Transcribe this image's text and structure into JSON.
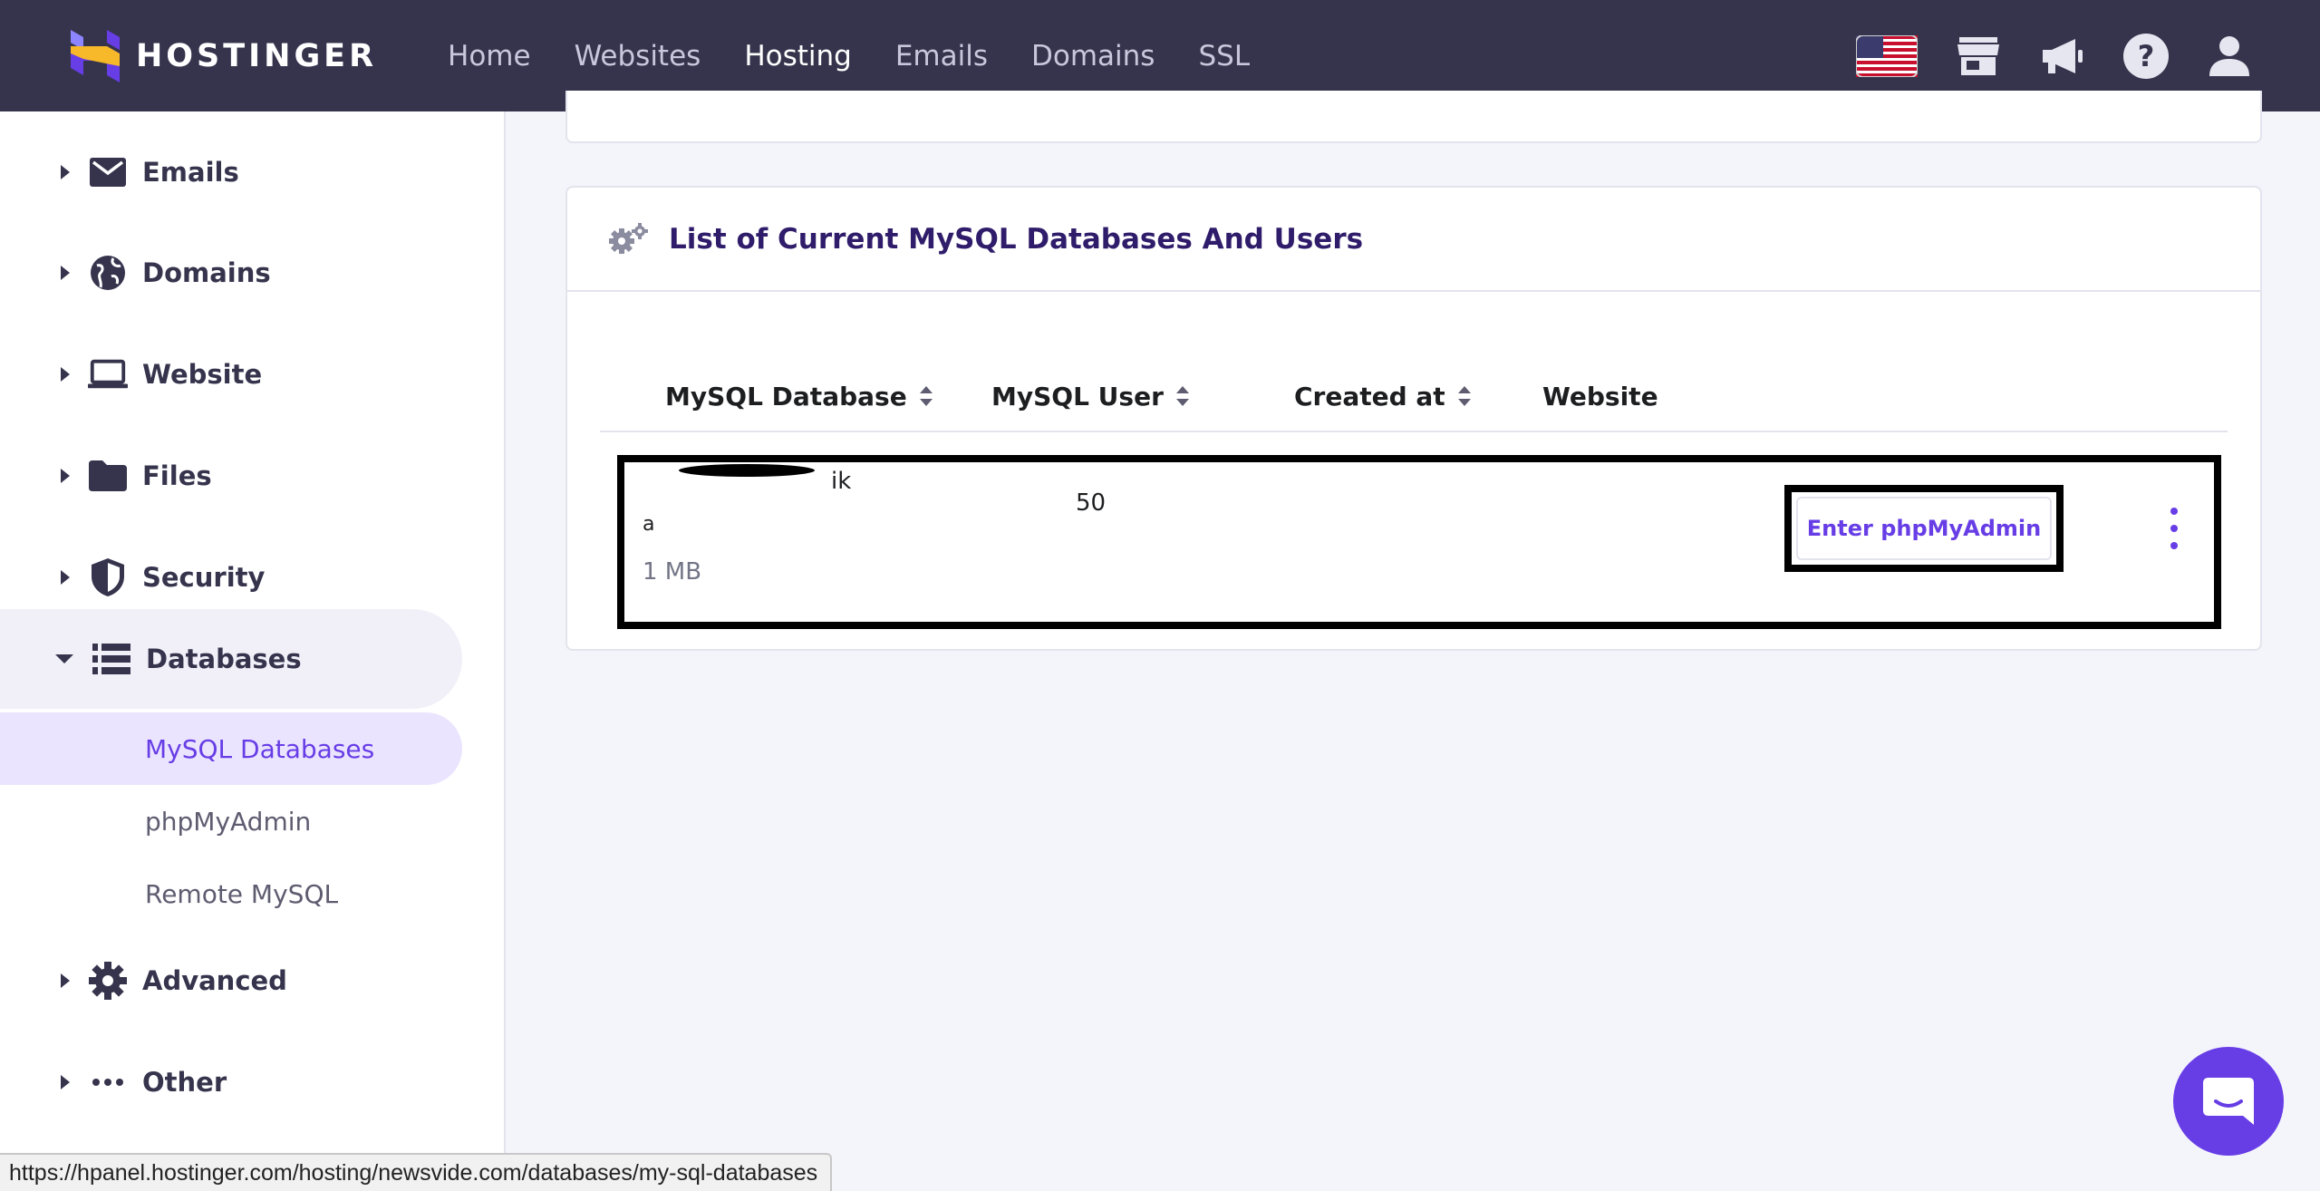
{
  "header": {
    "brand": "HOSTINGER",
    "nav": [
      {
        "label": "Home",
        "active": false
      },
      {
        "label": "Websites",
        "active": false
      },
      {
        "label": "Hosting",
        "active": true
      },
      {
        "label": "Emails",
        "active": false
      },
      {
        "label": "Domains",
        "active": false
      },
      {
        "label": "SSL",
        "active": false
      }
    ],
    "icons": [
      "us-flag-icon",
      "store-icon",
      "megaphone-icon",
      "help-icon",
      "user-icon"
    ]
  },
  "sidebar": {
    "items": [
      {
        "label": "Emails",
        "icon": "mail-icon"
      },
      {
        "label": "Domains",
        "icon": "globe-icon"
      },
      {
        "label": "Website",
        "icon": "laptop-icon"
      },
      {
        "label": "Files",
        "icon": "folder-icon"
      },
      {
        "label": "Security",
        "icon": "shield-icon"
      },
      {
        "label": "Databases",
        "icon": "database-icon",
        "expanded": true
      },
      {
        "label": "Advanced",
        "icon": "gear-icon"
      },
      {
        "label": "Other",
        "icon": "more-icon"
      }
    ],
    "sub_items": [
      {
        "label": "MySQL Databases",
        "active": true
      },
      {
        "label": "phpMyAdmin",
        "active": false
      },
      {
        "label": "Remote MySQL",
        "active": false
      }
    ]
  },
  "main": {
    "card_title": "List of Current MySQL Databases And Users",
    "columns": [
      {
        "label": "MySQL Database",
        "sortable": true
      },
      {
        "label": "MySQL User",
        "sortable": true
      },
      {
        "label": "Created at",
        "sortable": true
      },
      {
        "label": "Website",
        "sortable": false
      }
    ],
    "row": {
      "db_fragment_1": "ik",
      "db_fragment_2": "a",
      "user_fragment": "50",
      "size": "1 MB",
      "action_label": "Enter phpMyAdmin"
    }
  },
  "status_url": "https://hpanel.hostinger.com/hosting/newsvide.com/databases/my-sql-databases",
  "colors": {
    "header_bg": "#36344d",
    "accent": "#673de6",
    "page_bg": "#f4f4fb"
  }
}
